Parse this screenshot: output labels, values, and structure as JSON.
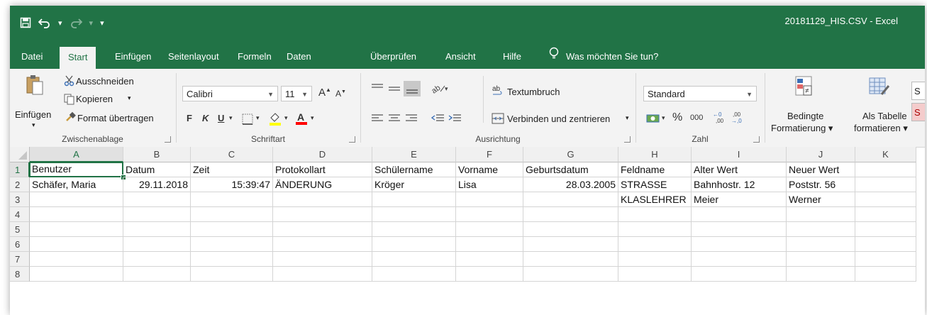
{
  "app": {
    "title": "20181129_HIS.CSV  -  Excel",
    "qat_more": "▾",
    "accent_color": "#217346"
  },
  "tabs": [
    "Datei",
    "Start",
    "Einfügen",
    "Seitenlayout",
    "Formeln",
    "Daten",
    "Überprüfen",
    "Ansicht",
    "Hilfe"
  ],
  "active_tab": "Start",
  "tell_me": "Was möchten Sie tun?",
  "ribbon": {
    "clipboard": {
      "paste": "Einfügen",
      "cut": "Ausschneiden",
      "copy": "Kopieren",
      "format_painter": "Format übertragen",
      "label": "Zwischenablage"
    },
    "font": {
      "name": "Calibri",
      "size": "11",
      "bold": "F",
      "italic": "K",
      "underline": "U",
      "label": "Schriftart"
    },
    "alignment": {
      "wrap": "Textumbruch",
      "merge": "Verbinden und zentrieren",
      "label": "Ausrichtung"
    },
    "number": {
      "format": "Standard",
      "percent": "%",
      "thousands": "000",
      "label": "Zahl"
    },
    "styles": {
      "conditional_line1": "Bedingte",
      "conditional_line2": "Formatierung ▾",
      "as_table_line1": "Als Tabelle",
      "as_table_line2": "formatieren ▾"
    }
  },
  "sheet": {
    "columns": [
      "A",
      "B",
      "C",
      "D",
      "E",
      "F",
      "G",
      "H",
      "I",
      "J",
      "K"
    ],
    "rows": [
      "1",
      "2",
      "3",
      "4",
      "5",
      "6",
      "7",
      "8"
    ],
    "cells": [
      [
        "Benutzer",
        "Datum",
        "Zeit",
        "Protokollart",
        "Schülername",
        "Vorname",
        "Geburtsdatum",
        "Feldname",
        "Alter Wert",
        "Neuer Wert",
        ""
      ],
      [
        "Schäfer, Maria",
        "29.11.2018",
        "15:39:47",
        "ÄNDERUNG",
        "Kröger",
        "Lisa",
        "28.03.2005",
        "STRASSE",
        "Bahnhostr. 12",
        "Poststr. 56",
        ""
      ],
      [
        "",
        "",
        "",
        "",
        "",
        "",
        "",
        "KLASLEHRER",
        "Meier",
        "Werner",
        ""
      ],
      [
        "",
        "",
        "",
        "",
        "",
        "",
        "",
        "",
        "",
        "",
        ""
      ],
      [
        "",
        "",
        "",
        "",
        "",
        "",
        "",
        "",
        "",
        "",
        ""
      ],
      [
        "",
        "",
        "",
        "",
        "",
        "",
        "",
        "",
        "",
        "",
        ""
      ],
      [
        "",
        "",
        "",
        "",
        "",
        "",
        "",
        "",
        "",
        "",
        ""
      ],
      [
        "",
        "",
        "",
        "",
        "",
        "",
        "",
        "",
        "",
        "",
        ""
      ]
    ],
    "active_cell": "A1"
  }
}
